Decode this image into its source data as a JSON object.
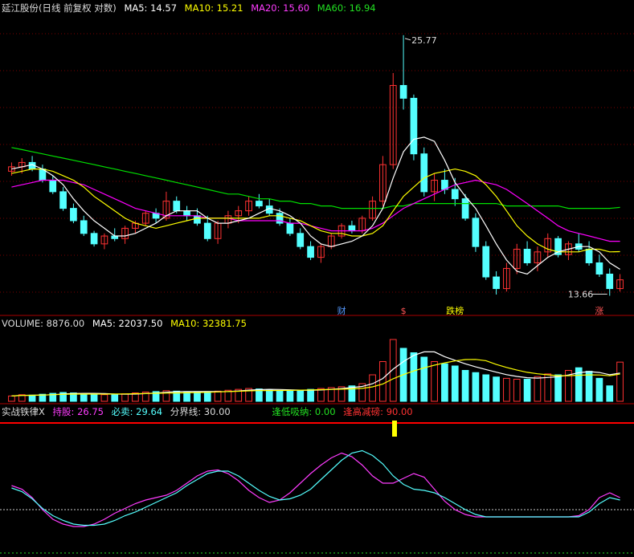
{
  "price_header": {
    "title": "延江股份(日线 前复权 对数)",
    "ma5": "MA5: 14.57",
    "ma10": "MA10: 15.21",
    "ma20": "MA20: 15.60",
    "ma60": "MA60: 16.94"
  },
  "volume_header": {
    "volume": "VOLUME: 8876.00",
    "ma5": "MA5: 22037.50",
    "ma10": "MA10: 32381.75"
  },
  "indicator_header": {
    "name": "实战铁律X",
    "hold": "持股: 26.75",
    "sell": "必卖: 29.64",
    "boundary": "分界线: 30.00",
    "low_absorb": "逢低吸纳: 0.00",
    "high_reduce": "逢高减磅: 90.00"
  },
  "colors": {
    "up": "#ff3232",
    "down": "#54ffff",
    "ma5": "#ffffff",
    "ma10": "#ffff00",
    "ma20": "#ff00ff",
    "ma60": "#00e000",
    "grid": "#7a0000"
  },
  "chart_data": {
    "type": "candlestick",
    "price_scale": "log",
    "price_ylim": [
      13.2,
      27.0
    ],
    "high_label": "25.77",
    "low_label": "13.66",
    "event_tags": [
      {
        "text": "财",
        "index": 32
      },
      {
        "text": "$",
        "index": 38
      },
      {
        "text": "跌榜",
        "index": 43
      },
      {
        "text": "涨",
        "index": 57
      }
    ],
    "ohlc": [
      [
        18.5,
        18.9,
        18.3,
        18.7
      ],
      [
        18.7,
        19.1,
        18.4,
        18.9
      ],
      [
        18.9,
        19.2,
        18.5,
        18.6
      ],
      [
        18.6,
        18.8,
        18.0,
        18.1
      ],
      [
        18.1,
        18.3,
        17.5,
        17.6
      ],
      [
        17.6,
        17.8,
        16.8,
        16.9
      ],
      [
        16.9,
        17.1,
        16.3,
        16.4
      ],
      [
        16.4,
        16.6,
        15.8,
        15.9
      ],
      [
        15.9,
        16.0,
        15.4,
        15.5
      ],
      [
        15.5,
        15.9,
        15.3,
        15.8
      ],
      [
        15.8,
        16.1,
        15.6,
        15.7
      ],
      [
        15.7,
        16.2,
        15.5,
        16.1
      ],
      [
        16.1,
        16.4,
        15.9,
        16.3
      ],
      [
        16.3,
        16.8,
        16.2,
        16.7
      ],
      [
        16.7,
        16.9,
        16.3,
        16.5
      ],
      [
        16.5,
        17.6,
        16.4,
        17.2
      ],
      [
        17.2,
        17.4,
        16.7,
        16.8
      ],
      [
        16.8,
        17.0,
        16.4,
        16.6
      ],
      [
        16.6,
        16.9,
        16.2,
        16.3
      ],
      [
        16.3,
        16.6,
        15.6,
        15.7
      ],
      [
        15.7,
        16.4,
        15.5,
        16.3
      ],
      [
        16.3,
        16.8,
        16.1,
        16.6
      ],
      [
        16.6,
        17.0,
        16.3,
        16.8
      ],
      [
        16.8,
        17.4,
        16.6,
        17.2
      ],
      [
        17.2,
        17.5,
        16.9,
        17.0
      ],
      [
        17.0,
        17.3,
        16.6,
        16.7
      ],
      [
        16.7,
        16.9,
        16.2,
        16.3
      ],
      [
        16.3,
        16.5,
        15.8,
        15.9
      ],
      [
        15.9,
        16.1,
        15.3,
        15.4
      ],
      [
        15.4,
        15.6,
        14.9,
        15.0
      ],
      [
        15.0,
        15.5,
        14.8,
        15.4
      ],
      [
        15.4,
        15.9,
        15.3,
        15.8
      ],
      [
        15.8,
        16.3,
        15.7,
        16.2
      ],
      [
        16.2,
        16.4,
        15.9,
        16.0
      ],
      [
        16.0,
        16.6,
        15.9,
        16.5
      ],
      [
        16.5,
        17.4,
        16.4,
        17.2
      ],
      [
        17.2,
        19.2,
        17.0,
        18.8
      ],
      [
        18.8,
        23.5,
        18.6,
        22.8
      ],
      [
        22.8,
        25.77,
        21.5,
        22.1
      ],
      [
        22.1,
        22.3,
        19.0,
        19.3
      ],
      [
        19.3,
        19.6,
        17.4,
        17.6
      ],
      [
        17.6,
        18.4,
        17.2,
        18.1
      ],
      [
        18.1,
        18.6,
        17.5,
        17.7
      ],
      [
        17.7,
        18.2,
        17.0,
        17.3
      ],
      [
        17.3,
        17.5,
        16.4,
        16.5
      ],
      [
        16.5,
        16.7,
        15.2,
        15.4
      ],
      [
        15.4,
        15.6,
        14.2,
        14.3
      ],
      [
        14.3,
        14.5,
        13.7,
        13.9
      ],
      [
        13.9,
        14.8,
        13.8,
        14.6
      ],
      [
        14.6,
        15.5,
        14.4,
        15.3
      ],
      [
        15.3,
        15.6,
        14.7,
        14.8
      ],
      [
        14.8,
        15.4,
        14.5,
        15.2
      ],
      [
        15.2,
        15.9,
        15.0,
        15.7
      ],
      [
        15.7,
        15.8,
        15.0,
        15.1
      ],
      [
        15.1,
        15.6,
        14.9,
        15.5
      ],
      [
        15.5,
        15.9,
        15.2,
        15.3
      ],
      [
        15.3,
        15.6,
        14.7,
        14.8
      ],
      [
        14.8,
        15.1,
        14.3,
        14.4
      ],
      [
        14.4,
        14.6,
        13.66,
        13.9
      ],
      [
        13.9,
        14.4,
        13.8,
        14.2
      ]
    ],
    "ma5": [
      18.6,
      18.7,
      18.8,
      18.6,
      18.3,
      17.9,
      17.3,
      16.8,
      16.4,
      16.1,
      15.8,
      15.8,
      15.9,
      16.1,
      16.3,
      16.6,
      16.8,
      16.8,
      16.8,
      16.5,
      16.3,
      16.3,
      16.4,
      16.5,
      16.7,
      16.9,
      16.8,
      16.6,
      16.3,
      15.8,
      15.5,
      15.4,
      15.5,
      15.6,
      15.8,
      16.2,
      16.9,
      18.2,
      19.4,
      20.0,
      20.1,
      19.9,
      19.0,
      18.0,
      17.4,
      16.9,
      16.2,
      15.5,
      14.9,
      14.5,
      14.4,
      14.7,
      15.0,
      15.2,
      15.3,
      15.4,
      15.4,
      15.2,
      14.8,
      14.57
    ],
    "ma10": [
      18.4,
      18.5,
      18.6,
      18.6,
      18.5,
      18.3,
      18.1,
      17.8,
      17.4,
      17.1,
      16.8,
      16.5,
      16.3,
      16.2,
      16.1,
      16.2,
      16.3,
      16.4,
      16.5,
      16.5,
      16.5,
      16.5,
      16.5,
      16.5,
      16.5,
      16.6,
      16.6,
      16.5,
      16.4,
      16.2,
      16.0,
      15.9,
      15.9,
      15.8,
      15.8,
      15.9,
      16.2,
      16.8,
      17.4,
      17.8,
      18.2,
      18.4,
      18.5,
      18.6,
      18.5,
      18.3,
      17.9,
      17.4,
      16.8,
      16.2,
      15.8,
      15.5,
      15.3,
      15.2,
      15.2,
      15.2,
      15.3,
      15.3,
      15.2,
      15.21
    ],
    "ma20": [
      17.8,
      17.9,
      18.0,
      18.1,
      18.1,
      18.1,
      18.0,
      17.9,
      17.7,
      17.5,
      17.3,
      17.1,
      16.9,
      16.8,
      16.7,
      16.6,
      16.6,
      16.6,
      16.6,
      16.5,
      16.5,
      16.5,
      16.4,
      16.4,
      16.4,
      16.4,
      16.4,
      16.3,
      16.3,
      16.2,
      16.1,
      16.0,
      16.0,
      16.0,
      16.0,
      16.1,
      16.3,
      16.6,
      16.9,
      17.1,
      17.3,
      17.5,
      17.7,
      17.9,
      18.0,
      18.1,
      18.0,
      17.9,
      17.7,
      17.4,
      17.1,
      16.8,
      16.5,
      16.2,
      16.0,
      15.9,
      15.8,
      15.7,
      15.6,
      15.6
    ],
    "ma60": [
      19.6,
      19.5,
      19.4,
      19.3,
      19.2,
      19.1,
      19.0,
      18.9,
      18.8,
      18.7,
      18.6,
      18.5,
      18.4,
      18.3,
      18.2,
      18.1,
      18.0,
      17.9,
      17.8,
      17.7,
      17.6,
      17.5,
      17.5,
      17.4,
      17.3,
      17.3,
      17.2,
      17.2,
      17.1,
      17.1,
      17.0,
      17.0,
      16.9,
      16.9,
      16.9,
      16.9,
      16.9,
      17.0,
      17.0,
      17.1,
      17.1,
      17.1,
      17.1,
      17.1,
      17.1,
      17.1,
      17.1,
      17.1,
      17.0,
      17.0,
      17.0,
      17.0,
      17.0,
      17.0,
      16.9,
      16.9,
      16.9,
      16.9,
      16.9,
      16.94
    ],
    "volume": [
      1200,
      1500,
      1400,
      1600,
      1800,
      2000,
      1900,
      1700,
      1600,
      1500,
      1500,
      1700,
      1900,
      2100,
      2200,
      2400,
      2300,
      2100,
      2000,
      2200,
      2300,
      2500,
      2700,
      2900,
      2800,
      2600,
      2400,
      2300,
      2500,
      2700,
      2900,
      3100,
      3300,
      3500,
      4000,
      6000,
      9000,
      14000,
      12000,
      11000,
      10000,
      9000,
      8500,
      8000,
      7000,
      6500,
      6000,
      5500,
      5200,
      5000,
      5000,
      5600,
      6200,
      6000,
      7000,
      7600,
      6800,
      5200,
      3500,
      8876
    ],
    "vol_ylim": [
      0,
      16000
    ],
    "hold": [
      50,
      47,
      40,
      30,
      22,
      18,
      16,
      16,
      18,
      22,
      27,
      31,
      35,
      38,
      40,
      42,
      46,
      52,
      58,
      62,
      63,
      60,
      54,
      46,
      40,
      36,
      38,
      44,
      52,
      60,
      67,
      73,
      77,
      74,
      67,
      58,
      52,
      52,
      56,
      60,
      57,
      47,
      37,
      30,
      26,
      24,
      24,
      24,
      24,
      24,
      24,
      24,
      24,
      24,
      24,
      25,
      30,
      40,
      44,
      40
    ],
    "sell": [
      48,
      45,
      39,
      31,
      25,
      21,
      18,
      17,
      17,
      18,
      21,
      25,
      28,
      32,
      36,
      40,
      44,
      50,
      55,
      60,
      62,
      62,
      58,
      52,
      46,
      41,
      38,
      39,
      42,
      47,
      55,
      63,
      71,
      77,
      79,
      75,
      68,
      58,
      51,
      47,
      46,
      44,
      40,
      35,
      30,
      26,
      24,
      24,
      24,
      24,
      24,
      24,
      24,
      24,
      24,
      24,
      28,
      35,
      40,
      38
    ],
    "ind_ylim": [
      0,
      100
    ],
    "boundary_value": 30
  }
}
